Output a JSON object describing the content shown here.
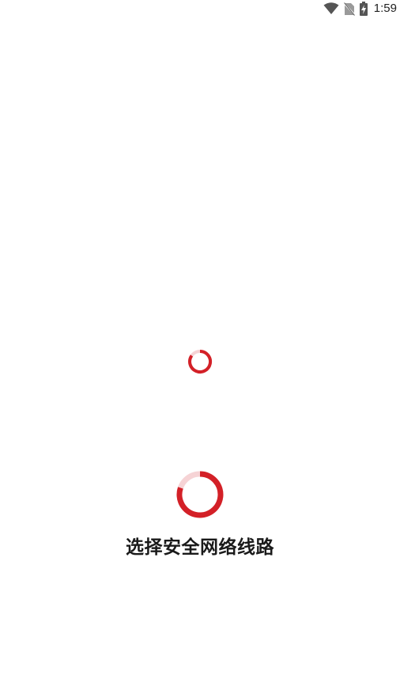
{
  "status_bar": {
    "time": "1:59",
    "icons": [
      "wifi-icon",
      "no-sim-icon",
      "battery-charging-icon"
    ]
  },
  "loading": {
    "message": "选择安全网络线路"
  },
  "colors": {
    "accent": "#d32027",
    "accent_light": "#f6d3d5",
    "text": "#1a1a1a",
    "status_icon": "#555555"
  }
}
